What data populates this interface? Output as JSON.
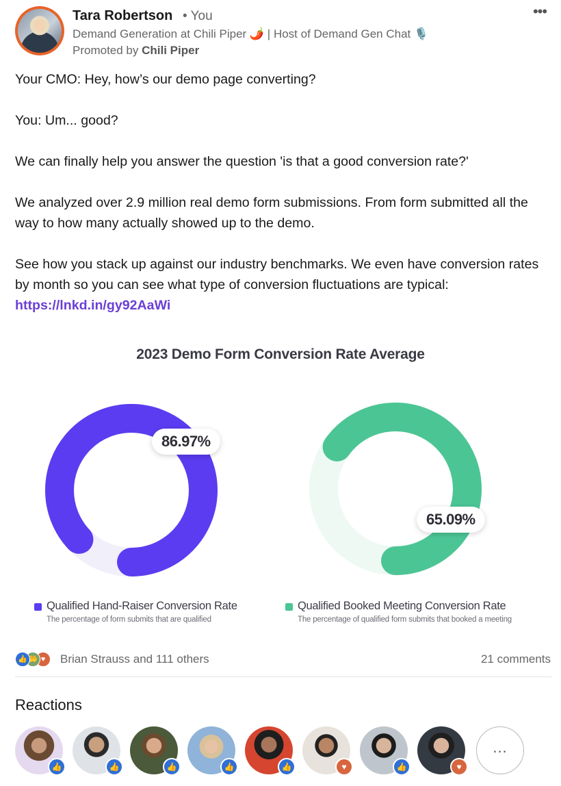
{
  "post": {
    "author_name": "Tara Robertson",
    "author_you": "• You",
    "author_headline": "Demand Generation at Chili Piper 🌶️ | Host of Demand Gen Chat 🎙️",
    "promoted_prefix": "Promoted by",
    "promoted_by": "Chili Piper",
    "more_label": "•••",
    "text": {
      "line1": "Your CMO: Hey, how’s our demo page converting?",
      "line2": "You: Um... good?",
      "line3": "We can finally help you answer the question 'is that a good conversion rate?'",
      "line4": "We analyzed over 2.9 million real demo form submissions. From form submitted all the way to how many actually showed up to the demo.",
      "line5": "See how you stack up against our industry benchmarks. We even have conversion rates by month so you can see what type of conversion fluctuations are typical:",
      "link": "https://lnkd.in/gy92AaWi"
    }
  },
  "chart_data": [
    {
      "type": "pie",
      "title": "2023 Demo Form Conversion Rate Average",
      "name": "Qualified Hand-Raiser Conversion Rate",
      "description": "The percentage of form submits that are qualified",
      "value": 86.97,
      "label": "86.97%",
      "color": "#5b3cf0",
      "track_color": "#f0effa"
    },
    {
      "type": "pie",
      "name": "Qualified Booked Meeting Conversion Rate",
      "description": "The percentage of qualified form submits that booked a meeting",
      "value": 65.09,
      "label": "65.09%",
      "color": "#4cc595",
      "track_color": "#eef9f4"
    }
  ],
  "social": {
    "reaction_icons": [
      "like-icon",
      "support-icon",
      "love-icon"
    ],
    "reactions_text": "Brian Strauss and 111 others",
    "comments_text": "21 comments",
    "reactions_heading": "Reactions",
    "reactors": [
      {
        "reaction": "like-icon"
      },
      {
        "reaction": "like-icon"
      },
      {
        "reaction": "like-icon"
      },
      {
        "reaction": "like-icon"
      },
      {
        "reaction": "like-icon"
      },
      {
        "reaction": "love-icon"
      },
      {
        "reaction": "like-icon"
      },
      {
        "reaction": "love-icon"
      }
    ],
    "more_reactors_label": "..."
  },
  "colors": {
    "link": "#6b3fd6",
    "avatar_ring": "#e8632b",
    "like": "#2f6fd6",
    "love": "#d7663f"
  }
}
